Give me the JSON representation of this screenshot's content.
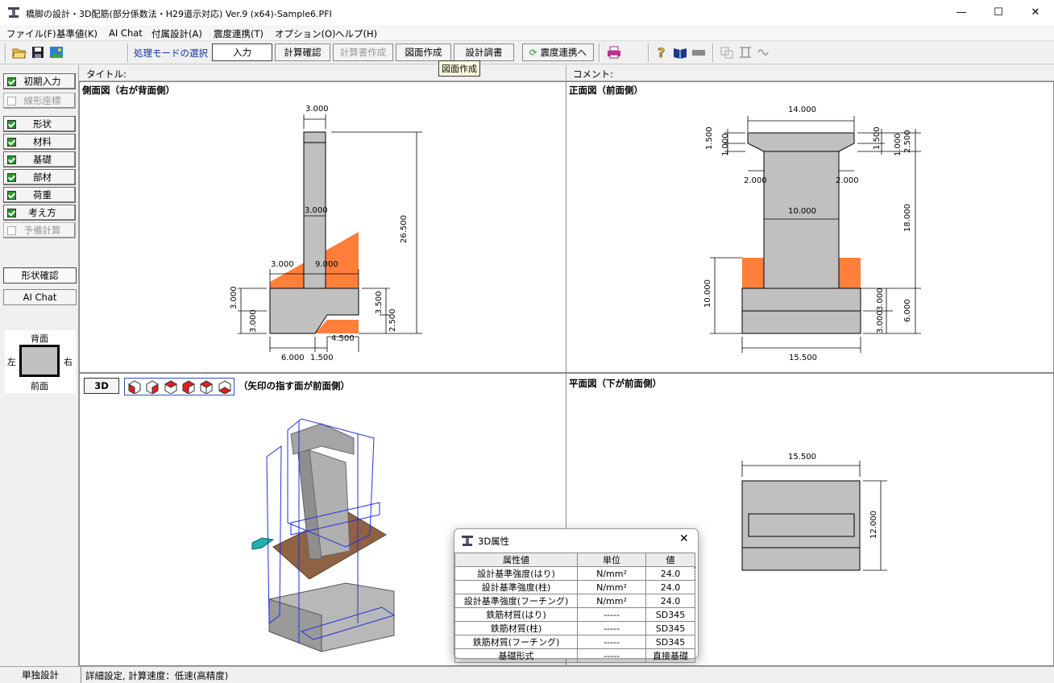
{
  "window": {
    "title": "橋脚の設計・3D配筋(部分係数法・H29道示対応) Ver.9 (x64)-Sample6.PFI",
    "minimize": "—",
    "maximize": "☐",
    "close": "✕"
  },
  "menu": [
    "ファイル(F)",
    "基準値(K)",
    "AI Chat",
    "付属設計(A)",
    "震度連携(T)",
    "オプション(O)",
    "ヘルプ(H)"
  ],
  "toolbar": {
    "mode_label": "処理モードの選択",
    "buttons": [
      "入力",
      "計算確認",
      "計算書作成",
      "図面作成",
      "設計調書",
      "震度連携へ"
    ],
    "tooltip": "図面作成"
  },
  "header": {
    "title_label": "タイトル:",
    "comment_label": "コメント:"
  },
  "left_panel": {
    "items": [
      {
        "label": "初期入力",
        "checked": true,
        "enabled": true
      },
      {
        "label": "線形座標",
        "checked": false,
        "enabled": false
      },
      {
        "label": "形状",
        "checked": true,
        "enabled": true
      },
      {
        "label": "材料",
        "checked": true,
        "enabled": true
      },
      {
        "label": "基礎",
        "checked": true,
        "enabled": true
      },
      {
        "label": "部材",
        "checked": true,
        "enabled": true
      },
      {
        "label": "荷重",
        "checked": true,
        "enabled": true
      },
      {
        "label": "考え方",
        "checked": true,
        "enabled": true
      },
      {
        "label": "予備計算",
        "checked": false,
        "enabled": false
      }
    ],
    "shape_check": "形状確認",
    "ai_chat": "AI Chat",
    "compass": {
      "top": "背面",
      "bottom": "前面",
      "left": "左",
      "right": "右"
    }
  },
  "views": {
    "side": {
      "title": "側面図（右が背面側）",
      "dims": [
        "3.000",
        "3.000",
        "26.500",
        "3.000",
        "9.000",
        "3.000",
        "3.000",
        "3.500",
        "2.500",
        "4.500",
        "6.000",
        "1.500"
      ]
    },
    "front": {
      "title": "正面図（前面側）",
      "dims": [
        "14.000",
        "1.500",
        "1.000",
        "1.500",
        "1.000",
        "2.500",
        "2.000",
        "2.000",
        "10.000",
        "18.000",
        "10.000",
        "3.000",
        "3.000",
        "6.000",
        "15.500"
      ]
    },
    "view3d": {
      "button": "3D",
      "title": "（矢印の指す面が前面側）"
    },
    "plan": {
      "title": "平面図（下が前面側）",
      "dims": [
        "15.500",
        "12.000"
      ]
    }
  },
  "dialog": {
    "title": "3D属性",
    "close": "✕",
    "headers": [
      "属性値",
      "単位",
      "値"
    ],
    "rows": [
      [
        "設計基準強度(はり)",
        "N/mm²",
        "24.0"
      ],
      [
        "設計基準強度(柱)",
        "N/mm²",
        "24.0"
      ],
      [
        "設計基準強度(フーチング)",
        "N/mm²",
        "24.0"
      ],
      [
        "鉄筋材質(はり)",
        "-----",
        "SD345"
      ],
      [
        "鉄筋材質(柱)",
        "-----",
        "SD345"
      ],
      [
        "鉄筋材質(フーチング)",
        "-----",
        "SD345"
      ],
      [
        "基礎形式",
        "-----",
        "直接基礎"
      ]
    ]
  },
  "status": {
    "mode": "単独設計",
    "message": "詳細設定, 計算速度：低速(高精度)"
  },
  "colors": {
    "concrete": "#c0c0c0",
    "soil": "#ff7f3a",
    "check_green": "#2a9a2a"
  }
}
